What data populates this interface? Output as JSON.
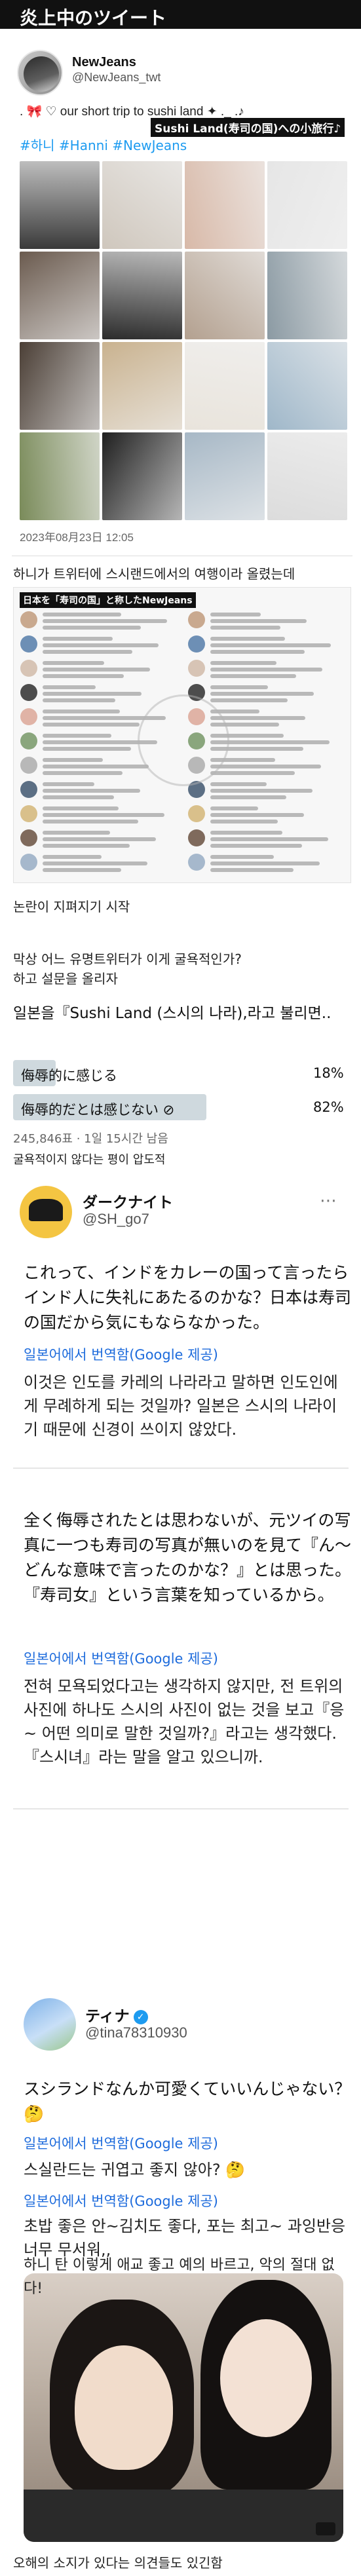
{
  "banner": {
    "title": "炎上中のツイート"
  },
  "tweet1": {
    "display_name": "NewJeans",
    "handle": "@NewJeans_twt",
    "text": ". 🎀 ♡ our short trip to sushi land ✦ ._ .♪",
    "highlight": "Sushi Land(寿司の国)への小旅行♪",
    "hashtags": "#하니 #Hanni #NewJeans",
    "date": "2023年08月23日 12:05",
    "photo_colors": [
      "#3a3a3a",
      "#cfc7bd",
      "#d8b9a8",
      "#e6e6e6",
      "#6b5b4f",
      "#2c2c2c",
      "#b3a08f",
      "#8b9aa3",
      "#4b3f36",
      "#c9b28f",
      "#e9e4dc",
      "#9fb7c9",
      "#7a8b5a",
      "#1f1f1f",
      "#a7b8c6",
      "#dcdcdc"
    ]
  },
  "caption_kr": "하니가 트위터에 스시랜드에서의 여행이라 올렸는데",
  "replies_highlight": "日本を「寿司の国」と称したNewJeans",
  "kr_lines": {
    "l1": "논란이 지펴지기 시작",
    "l2": "막상 어느 유명트위터가 이게 굴욕적인가?",
    "l3": "하고 설문을 올리자"
  },
  "poll": {
    "question": "일본을『Sushi Land (스시의 나라),라고 불리면..",
    "options": [
      {
        "label": "侮辱的に感じる",
        "percent": "18%",
        "share": 0.18
      },
      {
        "label": "侮辱的だとは感じない ⊘",
        "percent": "82%",
        "share": 0.82
      }
    ],
    "meta": "245,846표 · 1일 15시간 남음",
    "result": "굴욕적이지 않다는 평이 압도적"
  },
  "tweet2": {
    "display_name": "ダークナイト",
    "handle": "@SH_go7",
    "text_a": "これって、インドをカレーの国って言ったらインド人に失礼にあたるのかな？日本は寿司の国だから気にもならなかった。",
    "translate_label": "일본어에서 번역함(Google 제공)",
    "ko_a": "이것은 인도를 카레의 나라라고 말하면 인도인에게 무례하게 되는 것일까? 일본은 스시의 나라이기 때문에 신경이 쓰이지 않았다.",
    "text_b": "全く侮辱されたとは思わないが、元ツイの写真に一つも寿司の写真が無いのを見て『ん〜どんな意味で言ったのかな？』とは思った。『寿司女』という言葉を知っているから。",
    "translate_label_b": "일본어에서 번역함(Google 제공)",
    "ko_b": "전혀 모욕되었다고는 생각하지 않지만, 전 트위의 사진에 하나도 스시의 사진이 없는 것을 보고『응~ 어떤 의미로 말한 것일까?』라고는 생각했다.『스시녀』라는 말을 알고 있으니까."
  },
  "tweet3": {
    "display_name": "ティナ",
    "handle": "@tina78310930",
    "text": "スシランドなんか可愛くていいんじゃない？🤔",
    "translate_label": "일본어에서 번역함(Google 제공)",
    "ko": "스실란드는 귀엽고 좋지 않아? 🤔",
    "translate_label_b": "일본어에서 번역함(Google 제공)",
    "ko_b": "초밥 좋은 안~김치도 좋다, 포는 최고~ 과잉반응 너무 무서워,,",
    "ko_c": "하니 탄 이렇게 애교 좋고 예의 바르고, 악의 절대 없다!"
  },
  "footer": "오해의 소지가 있다는 의견들도 있긴함",
  "colors": {
    "accent": "#1d9bf0",
    "translate": "#1d6bdc",
    "poll_bar": "#cfd9de"
  }
}
